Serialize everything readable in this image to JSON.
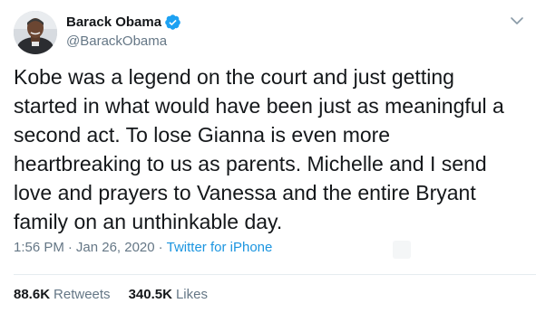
{
  "author": {
    "display_name": "Barack Obama",
    "handle": "@BarackObama",
    "verified": true,
    "avatar_icon": "person-avatar"
  },
  "tweet": {
    "text": "Kobe was a legend on the court and just getting started in what would have been just as meaningful a second act. To lose Gianna is even more heartbreaking to us as parents. Michelle and I send love and prayers to Vanessa and the entire Bryant family on an unthinkable day.",
    "time": "1:56 PM",
    "date": "Jan 26, 2020",
    "source": "Twitter for iPhone"
  },
  "meta": {
    "separator": "·"
  },
  "stats": {
    "retweets_count": "88.6K",
    "retweets_label": "Retweets",
    "likes_count": "340.5K",
    "likes_label": "Likes"
  },
  "colors": {
    "text": "#14171a",
    "secondary": "#657786",
    "link": "#1b95e0",
    "verified": "#1da1f2",
    "divider": "#e6ecf0"
  },
  "icons": {
    "verified": "verified-badge-icon",
    "caret": "chevron-down-icon"
  }
}
